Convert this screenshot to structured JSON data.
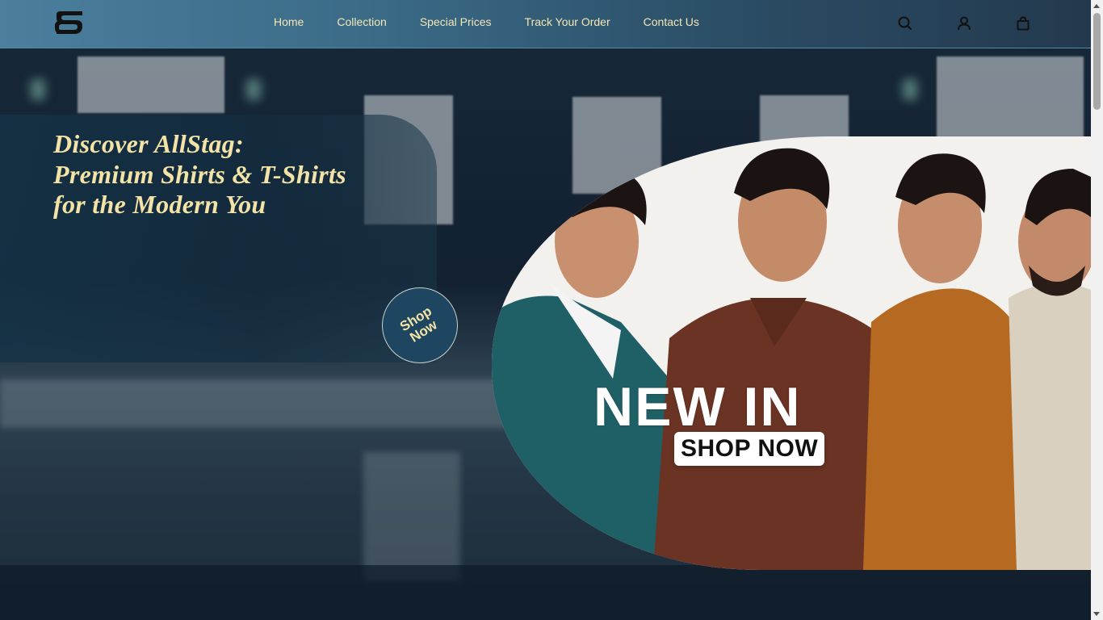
{
  "brand": {
    "logo_icon": "allstag-logo-icon"
  },
  "nav": {
    "items": [
      {
        "label": "Home"
      },
      {
        "label": "Collection"
      },
      {
        "label": "Special Prices"
      },
      {
        "label": "Track Your Order"
      },
      {
        "label": "Contact Us"
      }
    ]
  },
  "header_icons": [
    "search-icon",
    "user-icon",
    "shopping-bag-icon"
  ],
  "hero": {
    "title_lines": [
      "Discover AllStag:",
      "Premium Shirts & T-Shirts",
      "for the Modern You"
    ],
    "shop_button_label": "Shop Now"
  },
  "promo": {
    "headline": "NEW IN",
    "cta": "SHOP NOW"
  },
  "colors": {
    "accent_text": "#f3e3a6",
    "header_start": "#4b7f9d",
    "header_end": "#23394d"
  }
}
